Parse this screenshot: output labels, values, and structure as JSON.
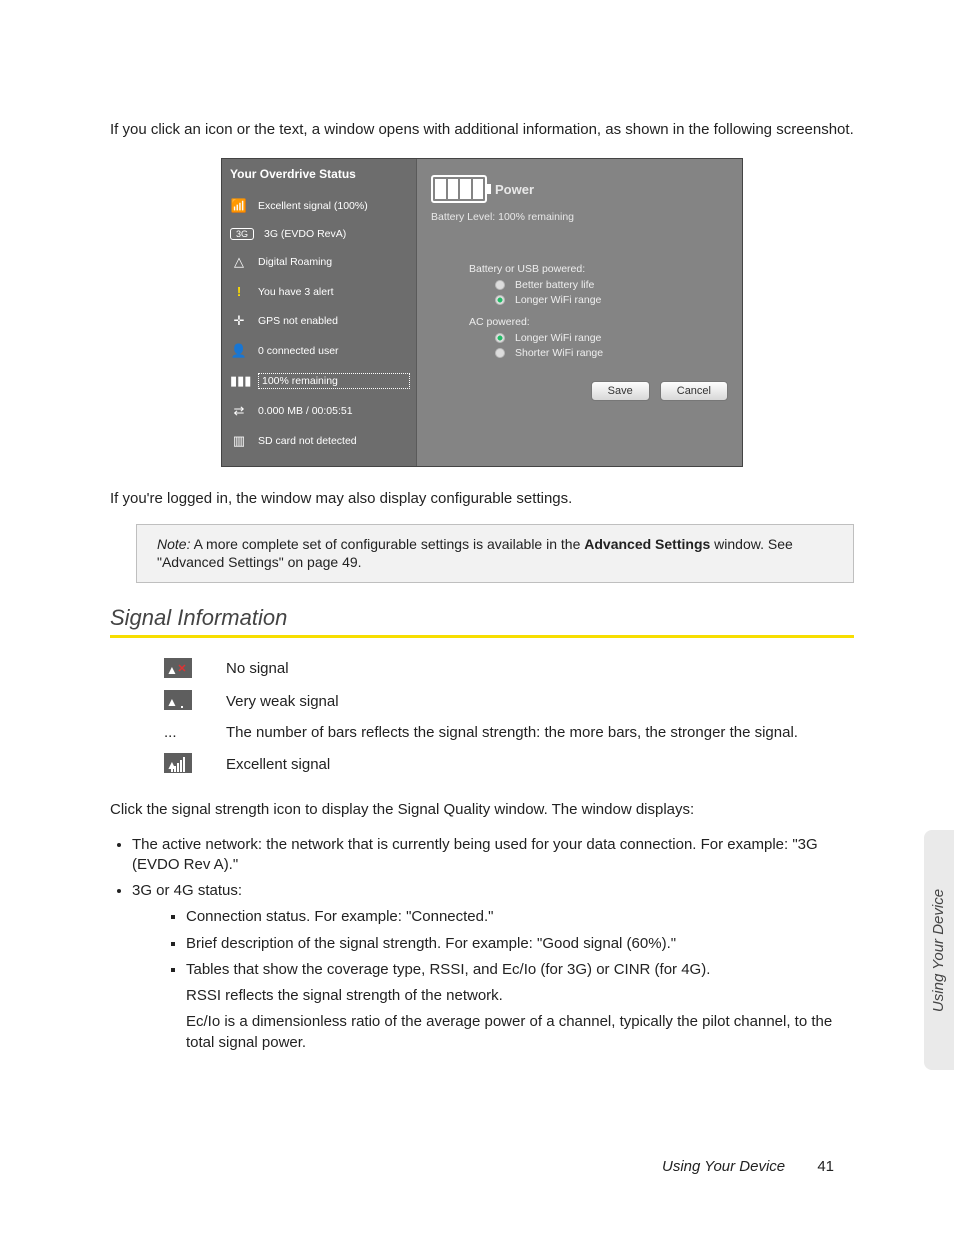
{
  "intro1": "If you click an icon or the text, a window opens with additional information, as shown in the following screenshot.",
  "intro2": "If you're logged in, the window may also display configurable settings.",
  "status_panel": {
    "title": "Your Overdrive Status",
    "rows": {
      "signal": "Excellent signal (100%)",
      "network": "3G (EVDO RevA)",
      "roaming": "Digital Roaming",
      "alerts": "You have 3 alert",
      "gps": "GPS not enabled",
      "users": "0 connected user",
      "battery": "100% remaining",
      "data": "0.000 MB / 00:05:51",
      "sd": "SD card not detected"
    }
  },
  "power_panel": {
    "title": "Power",
    "sub": "Battery Level: 100% remaining",
    "group1_head": "Battery or USB powered:",
    "group1_opt1": "Better battery life",
    "group1_opt2": "Longer WiFi range",
    "group2_head": "AC powered:",
    "group2_opt1": "Longer WiFi range",
    "group2_opt2": "Shorter WiFi range",
    "save": "Save",
    "cancel": "Cancel"
  },
  "note": {
    "label": "Note:",
    "text_a": "  A more complete set of configurable settings is available in the ",
    "bold": "Advanced Settings",
    "text_b": " window. See \"Advanced Settings\" on page 49."
  },
  "section_heading": "Signal Information",
  "sig_table": {
    "r1": "No signal",
    "r2": "Very weak signal",
    "r3_icon": "...",
    "r3": "The number of bars reflects the signal strength: the more bars, the stronger the signal.",
    "r4": "Excellent signal"
  },
  "para_after_table": "Click the signal strength icon to display the Signal Quality window. The window displays:",
  "bullets": {
    "b1": "The active network: the network that is currently being used for your data connection. For example: \"3G (EVDO Rev A).\"",
    "b2": "3G or 4G status:",
    "s1": "Connection status. For example: \"Connected.\"",
    "s2": "Brief description of the signal strength. For example: \"Good signal (60%).\"",
    "s3": "Tables that show the coverage type, RSSI, and Ec/Io (for 3G) or CINR (for 4G).",
    "p1": "RSSI reflects the signal strength of the network.",
    "p2": "Ec/Io is a dimensionless ratio of the average power of a channel, typically the pilot channel, to the total signal power."
  },
  "side_tab": "Using Your Device",
  "footer": {
    "title": "Using Your Device",
    "page": "41"
  }
}
